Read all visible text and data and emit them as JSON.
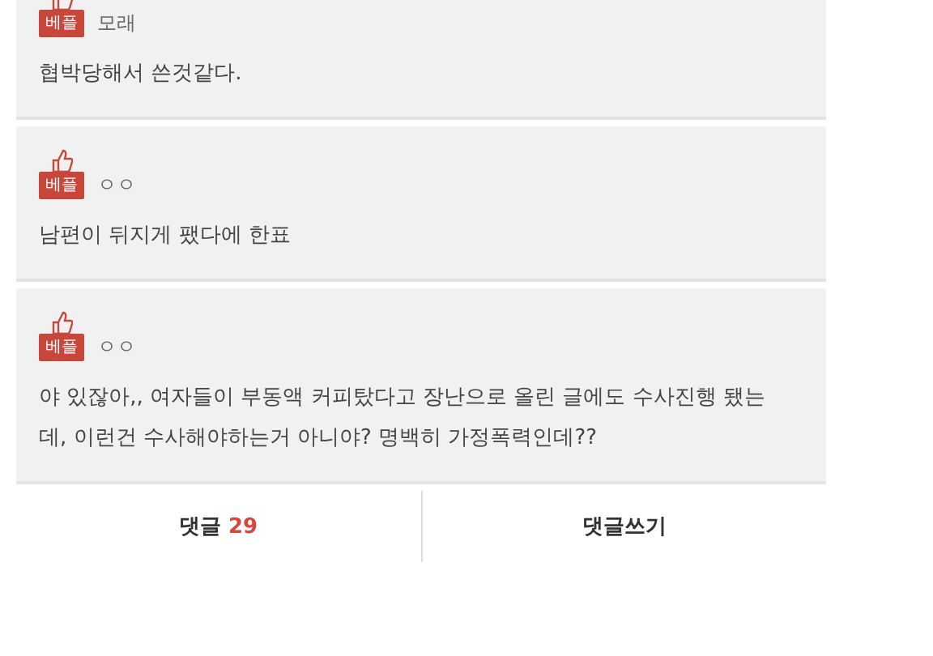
{
  "comments": [
    {
      "badge": "베플",
      "author": "모래",
      "text": "협박당해서 쓴것같다."
    },
    {
      "badge": "베플",
      "author": "ㅇㅇ",
      "text": "남편이 뒤지게 팼다에 한표"
    },
    {
      "badge": "베플",
      "author": "ㅇㅇ",
      "text": "야 있잖아,, 여자들이 부동액 커피탔다고 장난으로 올린 글에도 수사진행 됐는데, 이런건 수사해야하는거 아니야? 명백히 가정폭력인데??"
    }
  ],
  "footer": {
    "buttons": [
      {
        "label": "댓글",
        "count": "29"
      },
      {
        "label": "댓글쓰기"
      }
    ]
  }
}
